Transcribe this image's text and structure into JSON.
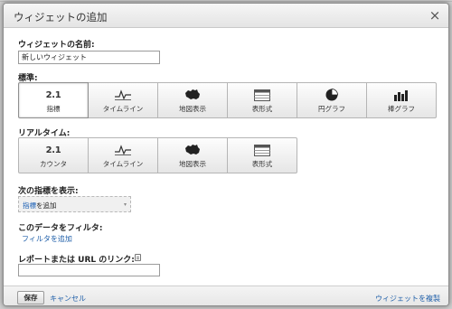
{
  "dialog": {
    "title": "ウィジェットの追加",
    "close_label": "×"
  },
  "widget_name": {
    "label": "ウィジェットの名前:",
    "value": "新しいウィジェット"
  },
  "standard": {
    "label": "標準:",
    "options": [
      {
        "icon": "metric-number-icon",
        "icon_text": "2.1",
        "label": "指標",
        "selected": true
      },
      {
        "icon": "timeline-icon",
        "icon_text": "",
        "label": "タイムライン",
        "selected": false
      },
      {
        "icon": "map-icon",
        "icon_text": "",
        "label": "地図表示",
        "selected": false
      },
      {
        "icon": "table-icon",
        "icon_text": "",
        "label": "表形式",
        "selected": false
      },
      {
        "icon": "pie-chart-icon",
        "icon_text": "",
        "label": "円グラフ",
        "selected": false
      },
      {
        "icon": "bar-chart-icon",
        "icon_text": "",
        "label": "棒グラフ",
        "selected": false
      }
    ]
  },
  "realtime": {
    "label": "リアルタイム:",
    "options": [
      {
        "icon": "counter-number-icon",
        "icon_text": "2.1",
        "label": "カウンタ"
      },
      {
        "icon": "timeline-icon",
        "icon_text": "",
        "label": "タイムライン"
      },
      {
        "icon": "map-icon",
        "icon_text": "",
        "label": "地図表示"
      },
      {
        "icon": "table-icon",
        "icon_text": "",
        "label": "表形式"
      }
    ]
  },
  "metric_display": {
    "label": "次の指標を表示:",
    "dropdown_prefix": "指標",
    "dropdown_suffix": "を追加",
    "arrow": "▾"
  },
  "filter": {
    "label": "このデータをフィルタ:",
    "add_link": "フィルタを追加"
  },
  "report_link": {
    "label": "レポートまたは URL のリンク:",
    "value": ""
  },
  "footer": {
    "save_label": "保存",
    "cancel_label": "キャンセル",
    "clone_label": "ウィジェットを複製"
  }
}
